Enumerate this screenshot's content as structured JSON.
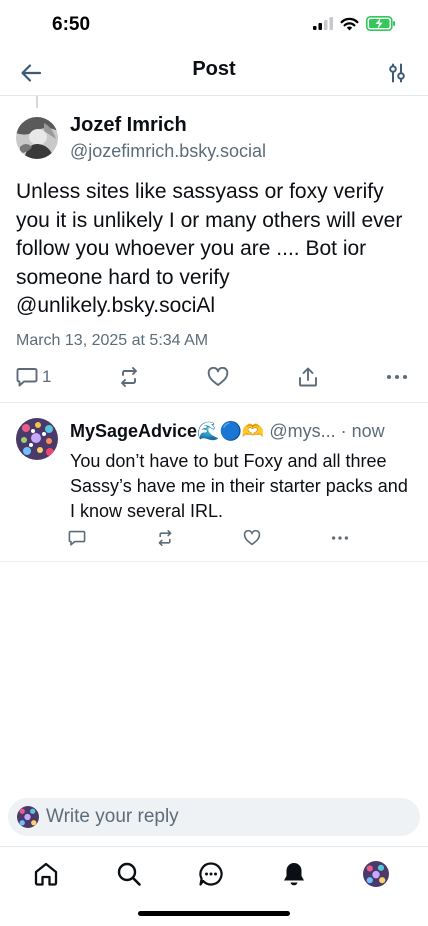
{
  "status_bar": {
    "time": "6:50"
  },
  "header": {
    "title": "Post"
  },
  "post": {
    "author_name": "Jozef Imrich",
    "author_handle": "@jozefimrich.bsky.social",
    "text": "Unless sites like sassyass or foxy verify you it is unlikely I or many others will ever follow you  whoever you are .... Bot ior someone hard to verify @unlikely.bsky.sociAl",
    "date": "March 13, 2025 at 5:34 AM",
    "reply_count": "1"
  },
  "reply": {
    "author_name": "MySageAdvice🌊🔵🫶",
    "author_handle": "@mys...",
    "time": "· now",
    "text": "You don’t have to but Foxy and all three Sassy’s have me in their starter packs and I know several IRL."
  },
  "composer": {
    "placeholder": "Write your reply"
  },
  "colors": {
    "accent": "#1083fe",
    "muted": "#5d6c7a",
    "text": "#0b0f14",
    "battery": "#34c759"
  },
  "icons": [
    "back-arrow-icon",
    "sliders-icon",
    "comment-icon",
    "repost-icon",
    "heart-icon",
    "share-icon",
    "more-icon",
    "home-icon",
    "search-icon",
    "chat-icon",
    "bell-icon"
  ]
}
